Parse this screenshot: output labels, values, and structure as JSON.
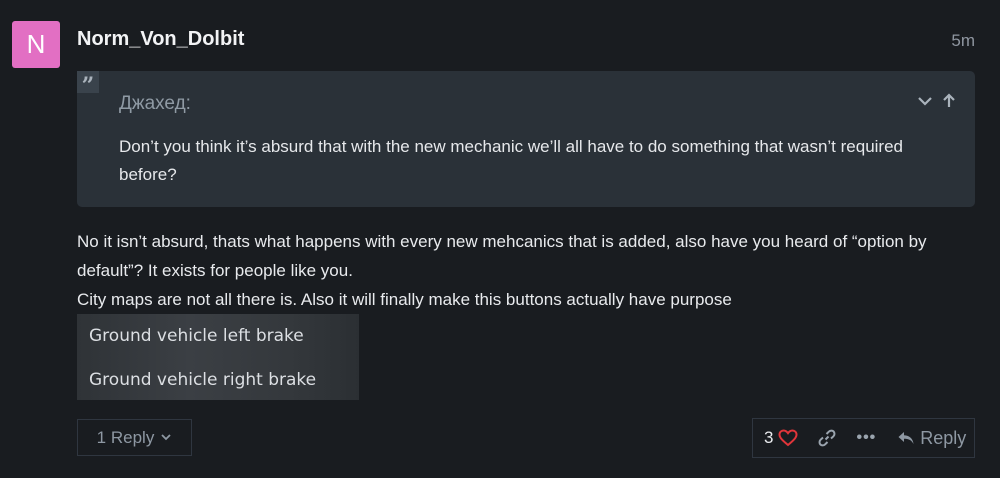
{
  "post": {
    "avatar_letter": "N",
    "avatar_color": "#e26fc3",
    "username": "Norm_Von_Dolbit",
    "age": "5m",
    "quote": {
      "author": "Джахед:",
      "text": "Don’t you think it’s absurd that with the new mechanic we’ll all have to do something that wasn’t required before?"
    },
    "body": {
      "paragraph1": "No it isn’t absurd, thats what happens with every new mehcanics that is added, also have you heard of “option by default”? It exists for people like you.",
      "paragraph2": "City maps are not all there is. Also it will finally make this buttons actually have purpose"
    },
    "image_lines": [
      "Ground vehicle left brake",
      "Ground vehicle right brake"
    ],
    "replies_label": "1 Reply",
    "like_count": "3",
    "reply_label": "Reply",
    "heart_color": "#e0353a"
  }
}
